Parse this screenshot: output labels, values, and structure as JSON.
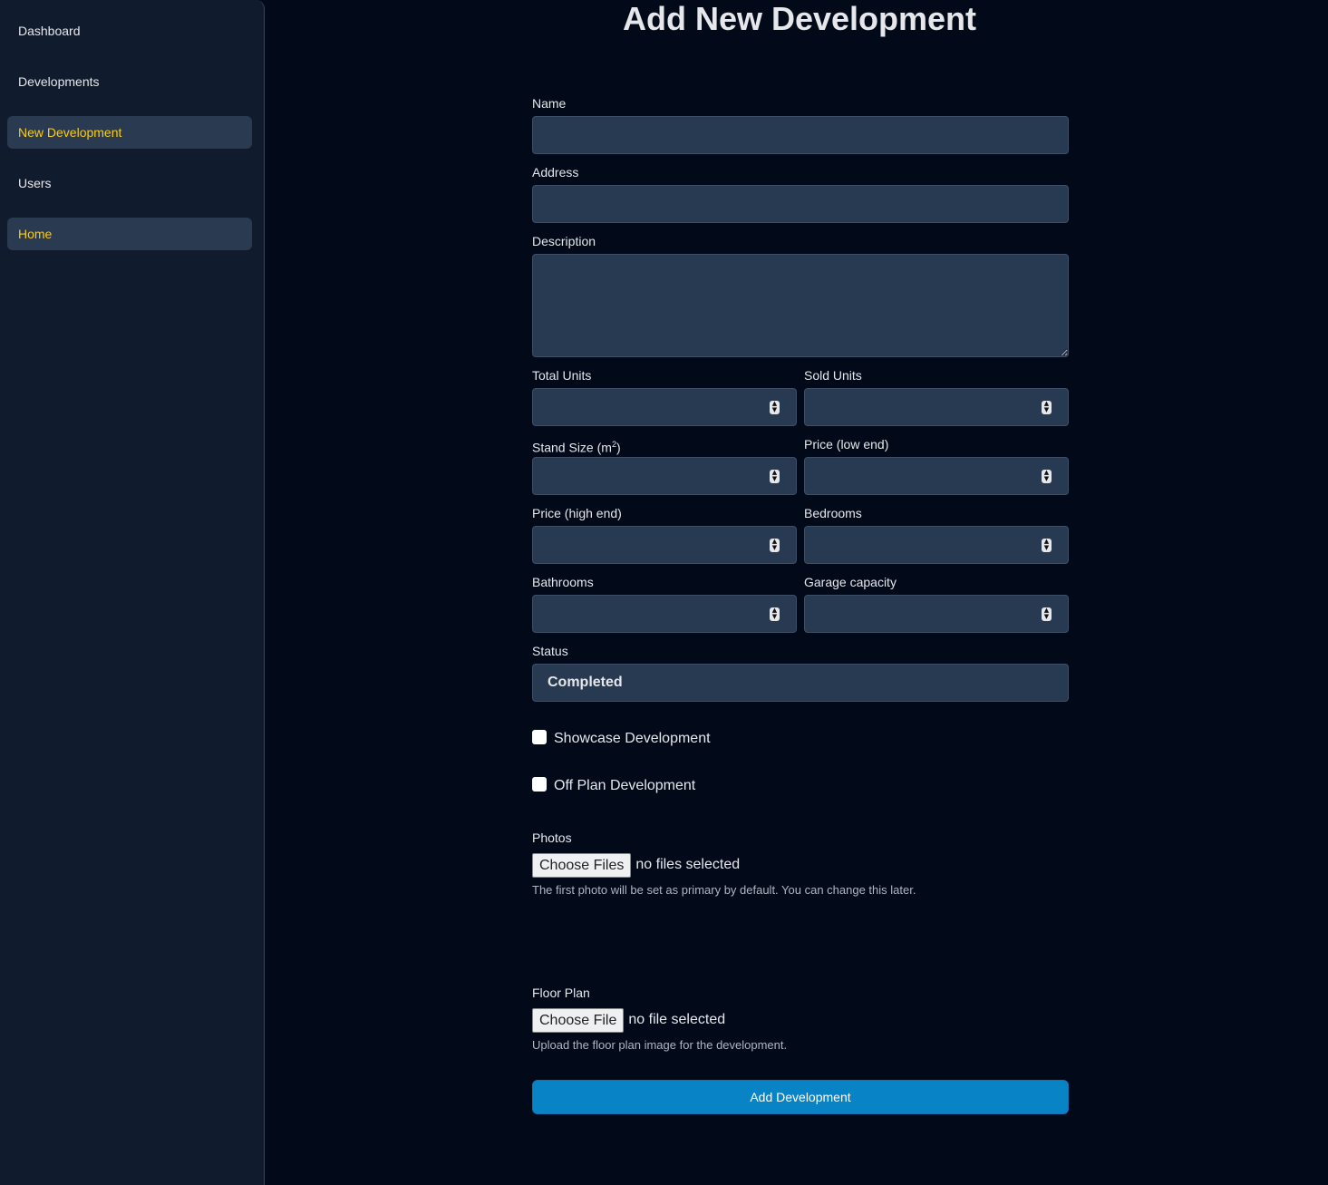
{
  "sidebar": {
    "items": [
      {
        "label": "Dashboard"
      },
      {
        "label": "Developments"
      },
      {
        "label": "New Development"
      },
      {
        "label": "Users"
      },
      {
        "label": "Home"
      }
    ]
  },
  "page": {
    "title": "Add New Development"
  },
  "form": {
    "name_label": "Name",
    "address_label": "Address",
    "description_label": "Description",
    "total_units_label": "Total Units",
    "sold_units_label": "Sold Units",
    "stand_size_label": "Stand Size (m",
    "stand_size_sup": "2",
    "stand_size_close": ")",
    "price_low_label": "Price (low end)",
    "price_high_label": "Price (high end)",
    "bedrooms_label": "Bedrooms",
    "bathrooms_label": "Bathrooms",
    "garage_label": "Garage capacity",
    "status_label": "Status",
    "status_value": "Completed",
    "showcase_label": "Showcase Development",
    "offplan_label": "Off Plan Development",
    "photos_label": "Photos",
    "photos_button": "Choose Files",
    "photos_status": "no files selected",
    "photos_help": "The first photo will be set as primary by default. You can change this later.",
    "floorplan_label": "Floor Plan",
    "floorplan_button": "Choose File",
    "floorplan_status": "no file selected",
    "floorplan_help": "Upload the floor plan image for the development.",
    "submit_label": "Add Development"
  }
}
